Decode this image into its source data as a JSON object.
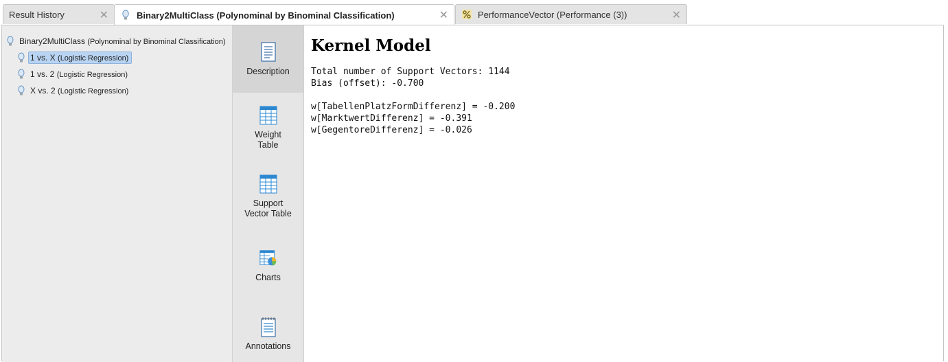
{
  "tabs": [
    {
      "label": "Result History",
      "close": "✕"
    },
    {
      "label": "Binary2MultiClass (Polynominal by Binominal Classification)",
      "close": "✕"
    },
    {
      "label": "PerformanceVector (Performance (3))",
      "close": "✕"
    }
  ],
  "tree": {
    "root": {
      "name": "Binary2MultiClass",
      "detail": "(Polynominal by Binominal Classification)",
      "icon": "bulb-icon"
    },
    "children": [
      {
        "name": "1 vs. X",
        "detail": "(Logistic Regression)",
        "icon": "bulb-icon",
        "selected": true
      },
      {
        "name": "1 vs. 2",
        "detail": "(Logistic Regression)",
        "icon": "bulb-icon"
      },
      {
        "name": "X vs. 2",
        "detail": "(Logistic Regression)",
        "icon": "bulb-icon"
      }
    ]
  },
  "views": [
    {
      "label": "Description",
      "icon": "document-icon",
      "active": true
    },
    {
      "label_line1": "Weight",
      "label_line2": "Table",
      "icon": "table-icon"
    },
    {
      "label_line1": "Support",
      "label_line2": "Vector Table",
      "icon": "table-icon"
    },
    {
      "label": "Charts",
      "icon": "chart-icon"
    },
    {
      "label": "Annotations",
      "icon": "notepad-icon"
    }
  ],
  "content": {
    "title": "Kernel Model",
    "summary": [
      "Total number of Support Vectors: 1144",
      "Bias (offset): -0.700"
    ],
    "weights": [
      "w[TabellenPlatzFormDifferenz] = -0.200",
      "w[MarktwertDifferenz] = -0.391",
      "w[GegentoreDifferenz] = -0.026"
    ]
  },
  "colors": {
    "selection": "#b8d4f2",
    "tree_bg": "#ececec",
    "views_bg": "#e6e6e6",
    "accent_blue": "#2a87d0"
  }
}
